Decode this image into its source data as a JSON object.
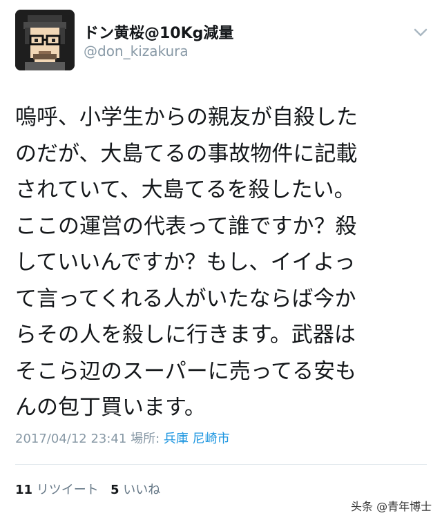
{
  "user": {
    "display_name": "ドン黄桜@10Kg減量",
    "handle": "@don_kizakura"
  },
  "tweet": {
    "lines": [
      "嗚呼、小学生からの親友が自殺した",
      "のだが、大島てるの事故物件に記載",
      "されていて、大島てるを殺したい。",
      "ここの運営の代表って誰ですか？殺",
      "していいんですか？もし、イイよっ",
      "て言ってくれる人がいたならば今か",
      "らその人を殺しに行きます。武器は",
      "そこら辺のスーパーに売ってる安も",
      "んの包丁買います。"
    ],
    "timestamp": "2017/04/12 23:41",
    "location_label": "場所:",
    "location": "兵庫 尼崎市"
  },
  "stats": {
    "retweets_count": "11",
    "retweets_label": "リツイート",
    "likes_count": "5",
    "likes_label": "いいね"
  },
  "watermark": "头条 @青年博士",
  "icons": {
    "avatar": "pixel-art-avatar",
    "menu": "chevron-down-icon"
  },
  "colors": {
    "text": "#14171a",
    "secondary": "#8899a6",
    "link": "#1b95e0",
    "divider": "#e1e8ed"
  }
}
